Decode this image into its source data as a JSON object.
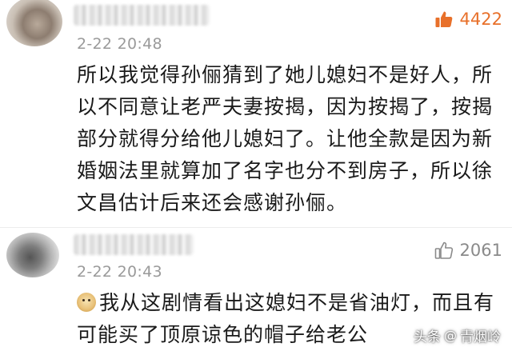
{
  "comments": [
    {
      "timestamp": "2-22 20:48",
      "likes": "4422",
      "liked": true,
      "lines": [
        "所以我觉得孙俪猜到了她儿媳妇不是好人，所",
        "以不同意让老严夫妻按揭，因为按揭了，按揭",
        "部分就得分给他儿媳妇了。让他全款是因为新",
        "婚姻法里就算加了名字也分不到房子，所以徐",
        "文昌估计后来还会感谢孙俪。"
      ]
    },
    {
      "timestamp": "2-22 20:43",
      "likes": "2061",
      "liked": false,
      "lines": [
        "我从这剧情看出这媳妇不是省油灯，而且有",
        "可能买了顶原谅色的帽子给老公"
      ],
      "emoji": "doge-emoji"
    }
  ],
  "watermark": {
    "prefix": "头条",
    "at": "@",
    "account": "青烟岭"
  },
  "colors": {
    "like_active": "#e8702a",
    "like_inactive": "#8a8a8a",
    "timestamp": "#9a9a9a",
    "text": "#1a1a1a"
  },
  "icons": {
    "like": "thumbs-up-icon",
    "avatar": "avatar",
    "emoji": "doge-emoji"
  }
}
